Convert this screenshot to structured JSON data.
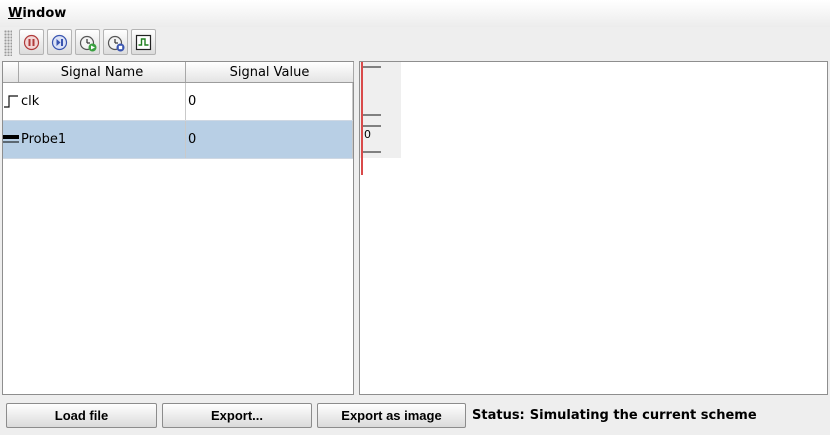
{
  "menu": {
    "window_label_mnemonic": "W",
    "window_label_rest": "indow"
  },
  "toolbar": {
    "buttons": [
      {
        "icon": "stop-icon",
        "color": "#c03030"
      },
      {
        "icon": "step-icon",
        "color": "#3050c0"
      },
      {
        "icon": "run-clock-icon",
        "color": "#208020"
      },
      {
        "icon": "stop-clock-icon",
        "color": "#3050c0"
      },
      {
        "icon": "waveform-icon",
        "color": "#208020"
      }
    ]
  },
  "table": {
    "headers": [
      "Signal Name",
      "Signal Value"
    ],
    "rows": [
      {
        "name": "clk",
        "value": "0",
        "icon": "clock-signal-icon",
        "selected": false
      },
      {
        "name": "Probe1",
        "value": "0",
        "icon": "bus-signal-icon",
        "selected": true
      }
    ]
  },
  "waveform": {
    "probe_value": "0",
    "cursor_color": "#d94a4a"
  },
  "bottom": {
    "load_label": "Load file",
    "export_label": "Export...",
    "export_image_label": "Export as image",
    "status_label": "Status:",
    "status_value": "Simulating the current scheme"
  }
}
